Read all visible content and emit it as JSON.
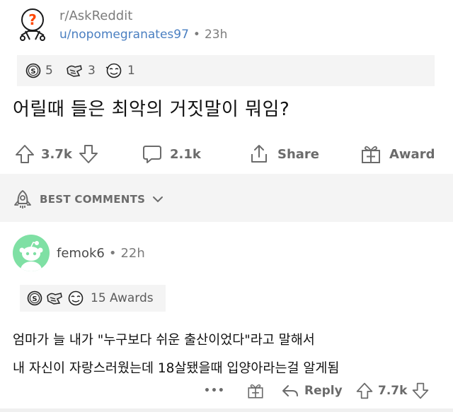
{
  "post": {
    "subreddit": "r/AskReddit",
    "author": "u/nopomegranates97",
    "separator": "•",
    "age": "23h",
    "awards": [
      {
        "icon": "silver-award-icon",
        "count": "5"
      },
      {
        "icon": "helpful-award-icon",
        "count": "3"
      },
      {
        "icon": "wholesome-award-icon",
        "count": "1"
      }
    ],
    "title": "어릴때 들은 최악의 거짓말이 뭐임?",
    "upvotes": "3.7k",
    "comments": "2.1k",
    "share_label": "Share",
    "award_label": "Award"
  },
  "comments_header": {
    "label": "BEST COMMENTS"
  },
  "comment": {
    "author": "femok6",
    "separator": "•",
    "age": "22h",
    "awards_count": "15 Awards",
    "lines": [
      "엄마가 늘 내가 \"누구보다 쉬운 출산이었다\"라고 말해서",
      "내 자신이 자랑스러웠는데 18살됐을때 입양아라는걸 알게됨"
    ],
    "more_label": "•••",
    "reply_label": "Reply",
    "upvotes": "7.7k"
  },
  "colors": {
    "link_blue": "#4a7fc1",
    "muted_gray": "#6b6b6b",
    "band_gray": "#f4f4f4",
    "avatar_green": "#7fe0a4"
  }
}
